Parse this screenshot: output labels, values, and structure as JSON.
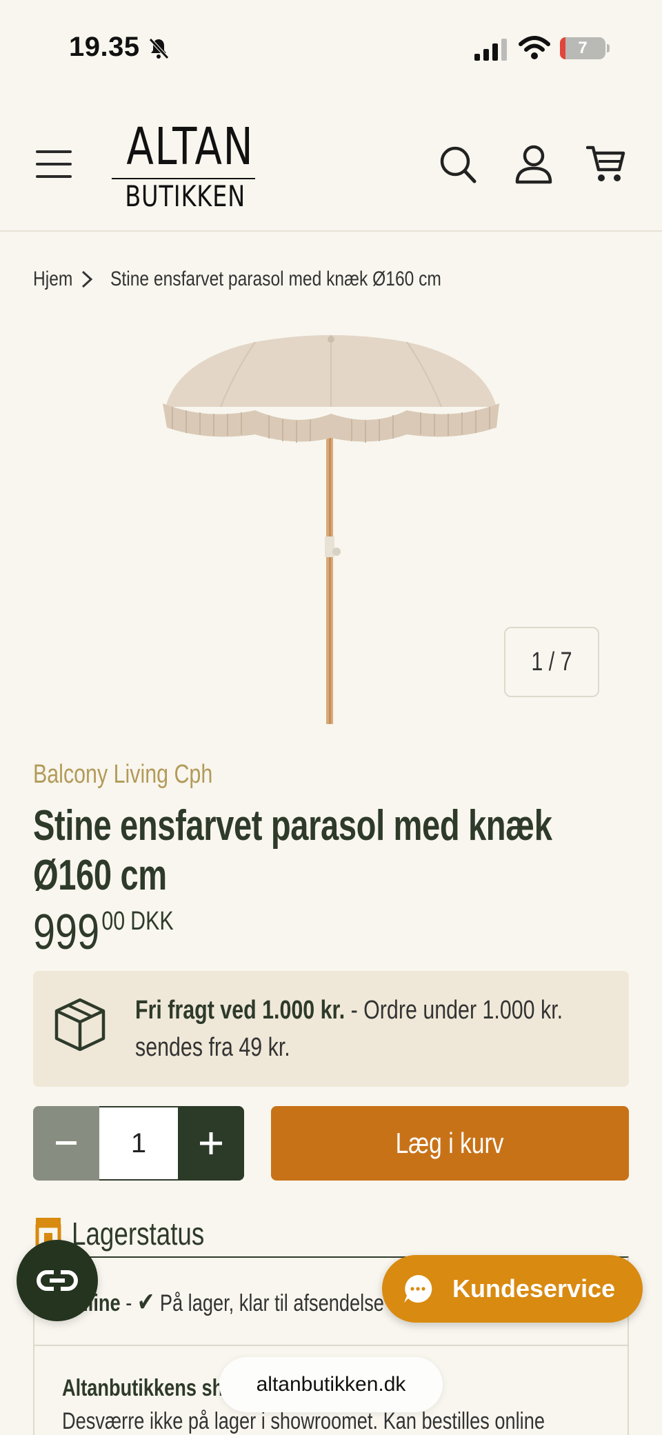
{
  "status_bar": {
    "time": "19.35",
    "battery": "7"
  },
  "header": {
    "logo_top": "ALTAN",
    "logo_bottom": "BUTIKKEN"
  },
  "breadcrumb": {
    "home": "Hjem",
    "current": "Stine ensfarvet parasol med knæk Ø160 cm"
  },
  "gallery": {
    "counter": "1 / 7"
  },
  "product": {
    "vendor": "Balcony Living Cph",
    "title": "Stine ensfarvet parasol med knæk Ø160 cm",
    "price_main": "999",
    "price_cents": "00",
    "price_currency": "DKK"
  },
  "shipping": {
    "bold": "Fri fragt ved 1.000 kr.",
    "text": " - Ordre under 1.000 kr. sendes fra 49 kr."
  },
  "cart": {
    "quantity": "1",
    "add_label": "Læg i kurv"
  },
  "stock": {
    "title": "Lagerstatus",
    "online_label": "Online",
    "online_sep": " - ",
    "online_status": "På lager, klar til afsendelse",
    "showroom_label": "Altanbutikkens showroom",
    "showroom_status": "Desværre ikke på lager i showroomet. Kan bestilles online"
  },
  "support": {
    "label": "Kundeservice"
  },
  "browser": {
    "url": "altanbutikken.dk"
  },
  "colors": {
    "background": "#f8f6ee",
    "primary_dark": "#2e3a2a",
    "accent_orange": "#c87218",
    "vendor_gold": "#b39a5a",
    "shipping_bg": "#efe8d8"
  }
}
